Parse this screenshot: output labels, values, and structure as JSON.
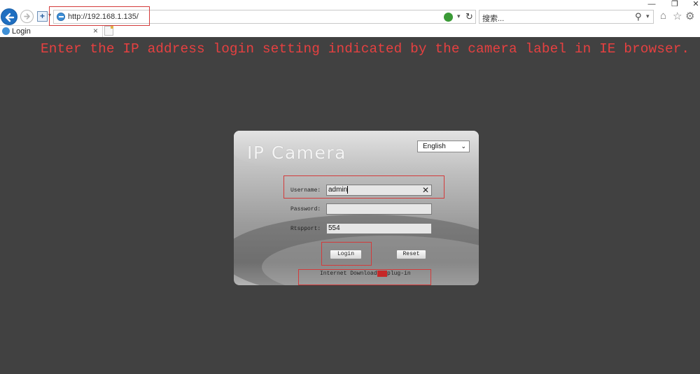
{
  "browser": {
    "url": "http://192.168.1.135/",
    "search_placeholder": "搜索...",
    "tab_title": "Login",
    "window_controls": {
      "minimize": "—",
      "restore": "❐",
      "close": "✕"
    }
  },
  "instruction": "Enter the IP address login setting indicated by the camera label in IE browser.",
  "login_panel": {
    "title": "IP Camera",
    "language": "English",
    "fields": {
      "username_label": "Username:",
      "username_value": "admin",
      "password_label": "Password:",
      "password_value": "",
      "rtspport_label": "Rtspport:",
      "rtspport_value": "554"
    },
    "login_label": "Login",
    "reset_label": "Reset",
    "plugin_text_before": "Internet Download",
    "plugin_text_highlight": "   ",
    "plugin_text_after": "plug-in"
  },
  "colors": {
    "page_background": "#414141",
    "annotation_red": "#e64040",
    "browser_accent": "#1f6fc1"
  },
  "icons": [
    "back-arrow-icon",
    "forward-arrow-icon",
    "favorites-icon",
    "ie-logo-icon",
    "compat-view-icon",
    "refresh-icon",
    "search-icon",
    "home-icon",
    "star-icon",
    "gear-icon",
    "close-icon",
    "new-tab-icon"
  ]
}
